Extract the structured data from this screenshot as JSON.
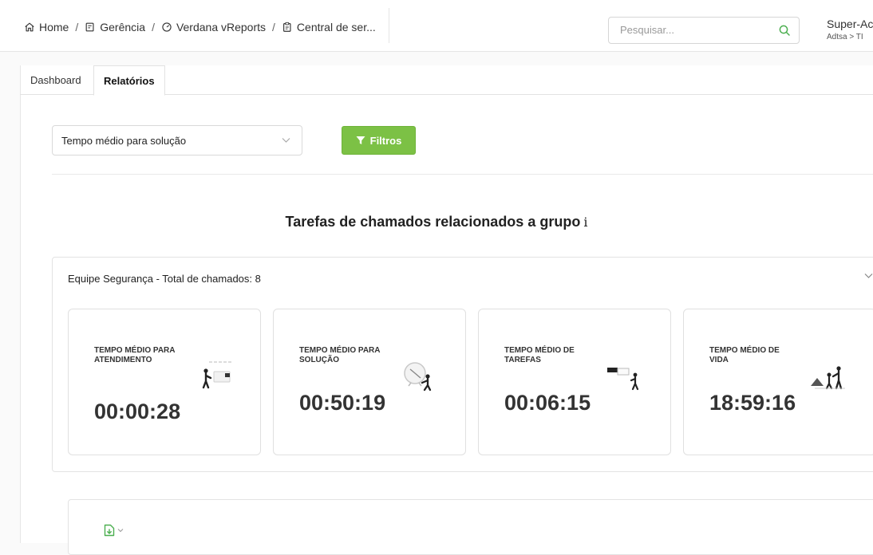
{
  "breadcrumb": {
    "home": "Home",
    "management": "Gerência",
    "reports": "Verdana vReports",
    "service_center": "Central de ser..."
  },
  "search": {
    "placeholder": "Pesquisar..."
  },
  "user": {
    "name": "Super-Ac",
    "path": "Adtsa > TI"
  },
  "tabs": [
    {
      "label": "Dashboard",
      "active": false
    },
    {
      "label": "Relatórios",
      "active": true
    }
  ],
  "report_select": {
    "value": "Tempo médio para solução"
  },
  "filter_button": {
    "label": "Filtros"
  },
  "section": {
    "title": "Tarefas de chamados relacionados a grupo",
    "info_glyph": "i"
  },
  "group": {
    "title": "Equipe Segurança - Total de chamados: 8",
    "cards": [
      {
        "label": "TEMPO MÉDIO PARA ATENDIMENTO",
        "value": "00:00:28"
      },
      {
        "label": "TEMPO MÉDIO PARA SOLUÇÃO",
        "value": "00:50:19"
      },
      {
        "label": "TEMPO MÉDIO DE TAREFAS",
        "value": "00:06:15"
      },
      {
        "label": "TEMPO MÉDIO DE VIDA",
        "value": "18:59:16"
      }
    ]
  },
  "colors": {
    "accent": "#7cc145",
    "text": "#333333",
    "border": "#e3e3e3"
  },
  "icons": [
    "home-icon",
    "document-icon",
    "dashboard-icon",
    "report-icon",
    "search-icon",
    "chevron-down-icon",
    "filter-icon",
    "info-icon",
    "export-file-icon"
  ]
}
